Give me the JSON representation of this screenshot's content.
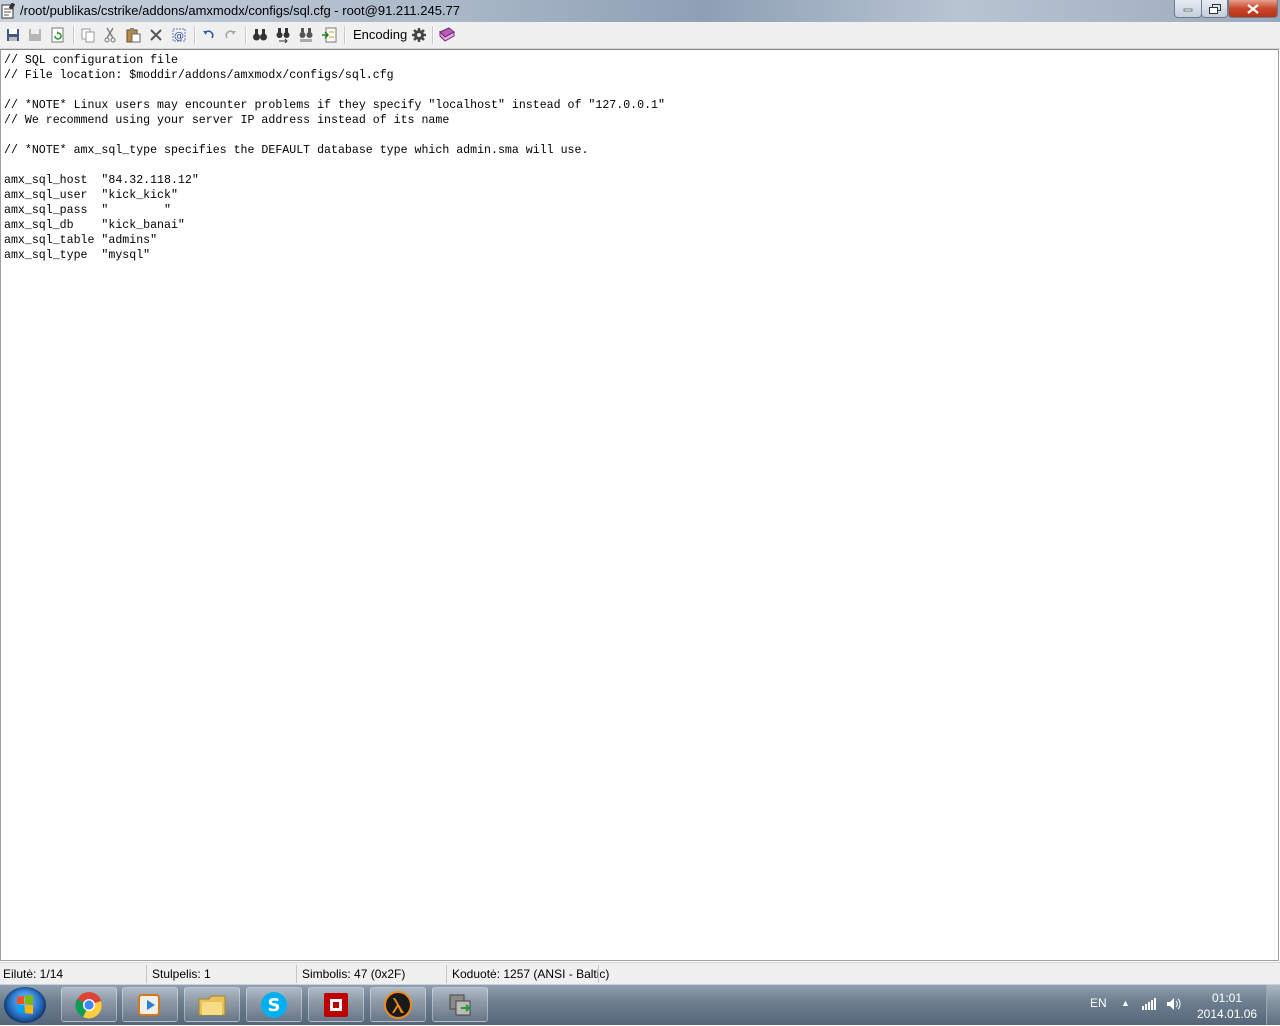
{
  "window": {
    "title": "/root/publikas/cstrike/addons/amxmodx/configs/sql.cfg - root@91.211.245.77"
  },
  "toolbar": {
    "encoding_label": "Encoding",
    "icons": [
      "save-file-icon",
      "save-icon",
      "reload-icon",
      "copy-icon",
      "cut-icon",
      "paste-icon",
      "delete-icon",
      "select-all-icon",
      "undo-icon",
      "redo-icon",
      "find-icon",
      "find-next-icon",
      "replace-icon",
      "go-to-line-icon",
      "settings-gear-icon",
      "help-book-icon"
    ]
  },
  "editor": {
    "lines": [
      "// SQL configuration file",
      "// File location: $moddir/addons/amxmodx/configs/sql.cfg",
      "",
      "// *NOTE* Linux users may encounter problems if they specify \"localhost\" instead of \"127.0.0.1\"",
      "// We recommend using your server IP address instead of its name",
      "",
      "// *NOTE* amx_sql_type specifies the DEFAULT database type which admin.sma will use.",
      "",
      "amx_sql_host  \"84.32.118.12\"",
      "amx_sql_user  \"kick_kick\"",
      "amx_sql_pass  \"        \"",
      "amx_sql_db    \"kick_banai\"",
      "amx_sql_table \"admins\"",
      "amx_sql_type  \"mysql\""
    ]
  },
  "status": {
    "line": "Eilutė: 1/14",
    "column": "Stulpelis: 1",
    "char": "Simbolis: 47 (0x2F)",
    "encoding": "Koduotė: 1257  (ANSI - Baltic)"
  },
  "taskbar": {
    "apps": [
      "chrome-icon",
      "media-player-icon",
      "file-explorer-icon",
      "skype-icon",
      "filezilla-icon",
      "half-life-icon",
      "winscp-icon"
    ],
    "lang": "EN",
    "time": "01:01",
    "date": "2014.01.06"
  },
  "colors": {
    "close_button": "#c9462c",
    "toolbar_bg": "#f0f0f0",
    "taskbar_bg": "#6e7f90"
  }
}
